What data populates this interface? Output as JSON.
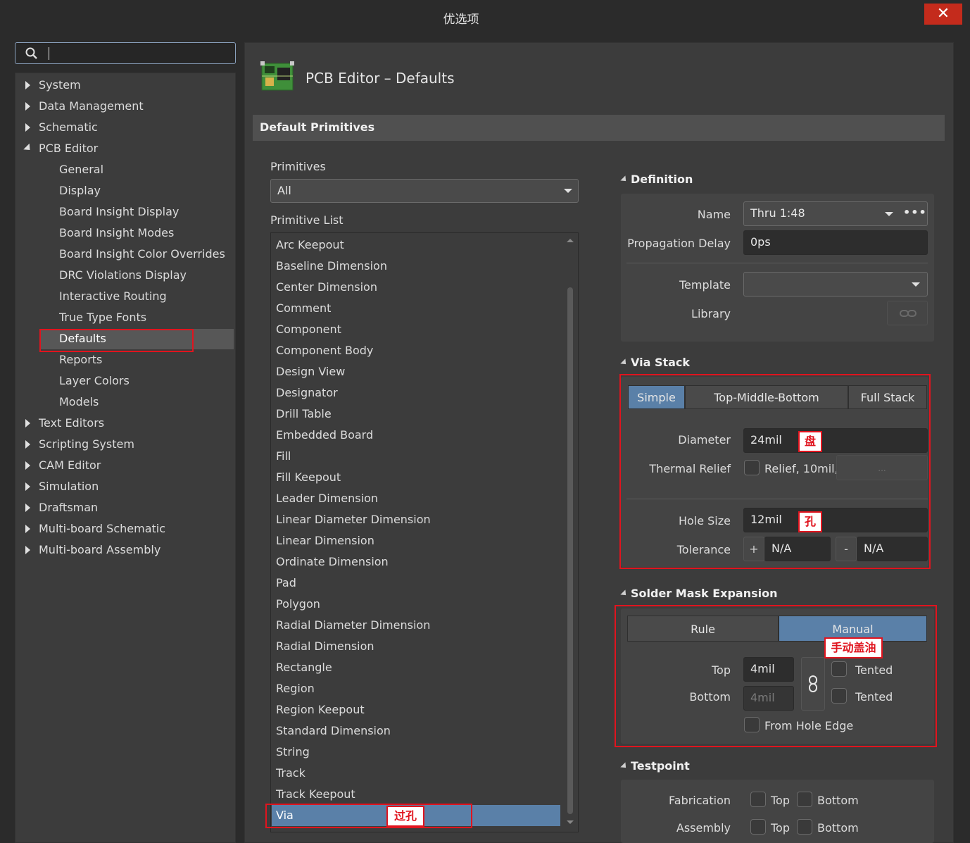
{
  "window": {
    "title": "优选项",
    "close_label": "✕"
  },
  "search": {
    "placeholder": ""
  },
  "tree": {
    "items": [
      {
        "label": "System",
        "expanded": false
      },
      {
        "label": "Data Management",
        "expanded": false
      },
      {
        "label": "Schematic",
        "expanded": false
      },
      {
        "label": "PCB Editor",
        "expanded": true
      },
      {
        "label": "General"
      },
      {
        "label": "Display"
      },
      {
        "label": "Board Insight Display"
      },
      {
        "label": "Board Insight Modes"
      },
      {
        "label": "Board Insight Color Overrides"
      },
      {
        "label": "DRC Violations Display"
      },
      {
        "label": "Interactive Routing"
      },
      {
        "label": "True Type Fonts"
      },
      {
        "label": "Defaults",
        "selected": true
      },
      {
        "label": "Reports"
      },
      {
        "label": "Layer Colors"
      },
      {
        "label": "Models"
      },
      {
        "label": "Text Editors",
        "expanded": false
      },
      {
        "label": "Scripting System",
        "expanded": false
      },
      {
        "label": "CAM Editor",
        "expanded": false
      },
      {
        "label": "Simulation",
        "expanded": false
      },
      {
        "label": "Draftsman",
        "expanded": false
      },
      {
        "label": "Multi-board Schematic",
        "expanded": false
      },
      {
        "label": "Multi-board Assembly",
        "expanded": false
      }
    ]
  },
  "page": {
    "title": "PCB Editor – Defaults",
    "icon": "pcb-board-icon"
  },
  "section": {
    "title": "Default Primitives"
  },
  "primitives": {
    "label": "Primitives",
    "selected": "All",
    "list_label": "Primitive List",
    "list": [
      "Arc Keepout",
      "Baseline Dimension",
      "Center Dimension",
      "Comment",
      "Component",
      "Component Body",
      "Design View",
      "Designator",
      "Drill Table",
      "Embedded Board",
      "Fill",
      "Fill Keepout",
      "Leader Dimension",
      "Linear Diameter Dimension",
      "Linear Dimension",
      "Ordinate Dimension",
      "Pad",
      "Polygon",
      "Radial Diameter Dimension",
      "Radial Dimension",
      "Rectangle",
      "Region",
      "Region Keepout",
      "Standard Dimension",
      "String",
      "Track",
      "Track Keepout",
      "Via"
    ],
    "selected_item": "Via"
  },
  "definition": {
    "title": "Definition",
    "name_label": "Name",
    "name_value": "Thru 1:48",
    "delay_label": "Propagation Delay",
    "delay_value": "0ps",
    "template_label": "Template",
    "template_value": "",
    "library_label": "Library"
  },
  "via_stack": {
    "title": "Via Stack",
    "tabs": [
      "Simple",
      "Top-Middle-Bottom",
      "Full Stack"
    ],
    "active_tab": "Simple",
    "diameter_label": "Diameter",
    "diameter_value": "24mil",
    "thermal_label": "Thermal Relief",
    "thermal_value": "Relief, 10mil,",
    "thermal_more": "...",
    "hole_label": "Hole Size",
    "hole_value": "12mil",
    "tolerance_label": "Tolerance",
    "tol_plus_sign": "+",
    "tol_plus": "N/A",
    "tol_minus_sign": "-",
    "tol_minus": "N/A"
  },
  "solder_mask": {
    "title": "Solder Mask Expansion",
    "tabs": [
      "Rule",
      "Manual"
    ],
    "active_tab": "Manual",
    "top_label": "Top",
    "top_value": "4mil",
    "bottom_label": "Bottom",
    "bottom_value": "4mil",
    "tented_label": "Tented",
    "tented_label_2": "Tented",
    "from_hole_edge_label": "From Hole Edge"
  },
  "testpoint": {
    "title": "Testpoint",
    "fabrication_label": "Fabrication",
    "assembly_label": "Assembly",
    "top_label": "Top",
    "bottom_label": "Bottom"
  },
  "annotations": {
    "pad": "盘",
    "hole": "孔",
    "manual_tent": "手动盖油",
    "via": "过孔"
  },
  "colors": {
    "accent": "#5a80a8",
    "highlight": "#e0141e",
    "close": "#c42b1c"
  }
}
